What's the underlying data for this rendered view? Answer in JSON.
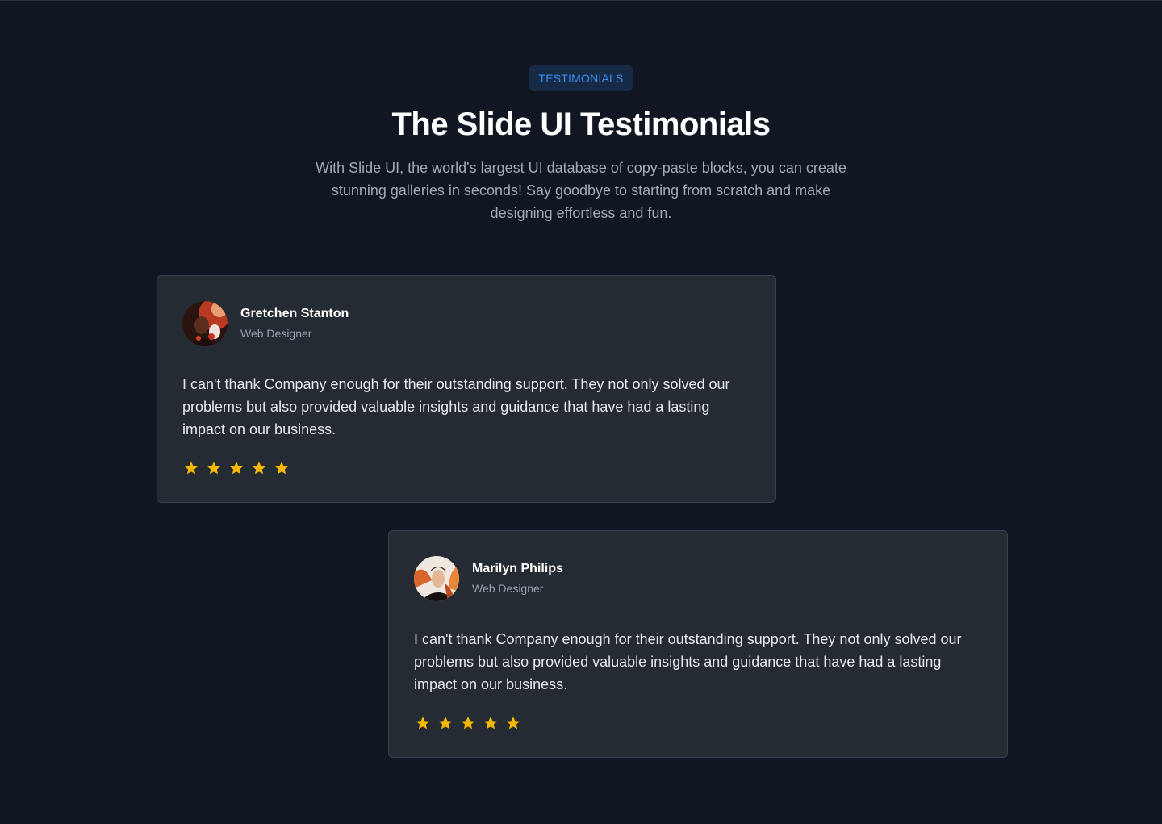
{
  "section": {
    "badge": "TESTIMONIALS",
    "title": "The Slide UI Testimonials",
    "subtitle": "With Slide UI, the world's largest UI database of copy-paste blocks, you can create stunning galleries in seconds! Say goodbye to starting from scratch and make designing effortless and fun."
  },
  "testimonials": [
    {
      "name": "Gretchen Stanton",
      "role": "Web Designer",
      "quote": "I can't thank Company enough for their outstanding support. They not only solved our problems but also provided valuable insights and guidance that have had a lasting impact on our business.",
      "rating": 5,
      "avatar_icon": "avatar-photo"
    },
    {
      "name": "Marilyn Philips",
      "role": "Web Designer",
      "quote": "I can't thank Company enough for their outstanding support. They not only solved our problems but also provided valuable insights and guidance that have had a lasting impact on our business.",
      "rating": 5,
      "avatar_icon": "avatar-photo"
    }
  ],
  "colors": {
    "background": "#111722",
    "card": "#252b32",
    "badge_bg": "#172a45",
    "badge_text": "#3b8cf0",
    "star": "#f5b800"
  }
}
